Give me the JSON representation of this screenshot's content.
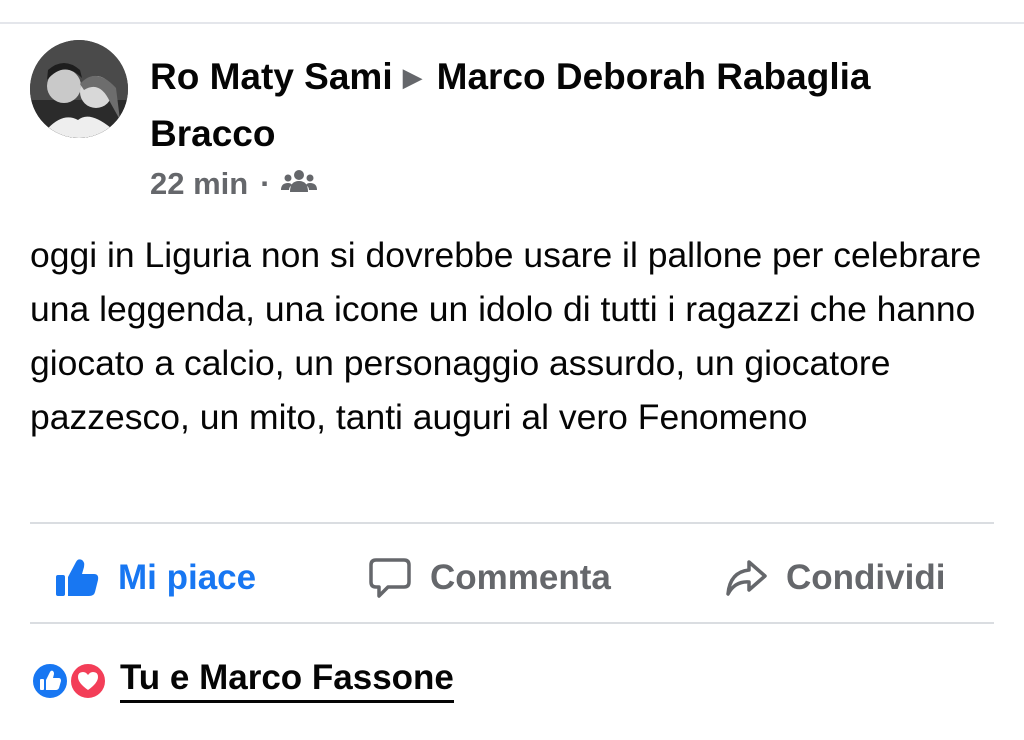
{
  "post": {
    "author": "Ro Maty Sami",
    "target": "Marco Deborah Rabaglia Bracco",
    "time": "22 min",
    "separator": "·",
    "audience_icon": "group-icon",
    "text": "oggi in Liguria non si dovrebbe usare il pallone per celebrare una leggenda, una icone un idolo di tutti i ragazzi che hanno giocato a calcio, un personaggio assurdo, un giocatore pazzesco, un mito, tanti auguri al vero Fenomeno"
  },
  "actions": {
    "like_label": "Mi piace",
    "comment_label": "Commenta",
    "share_label": "Condividi"
  },
  "reactions": {
    "icons": [
      "like-reaction-icon",
      "love-reaction-icon"
    ],
    "summary": "Tu e Marco Fassone"
  },
  "colors": {
    "accent": "#1877f2",
    "secondary_text": "#65676b",
    "love": "#f33e58"
  }
}
